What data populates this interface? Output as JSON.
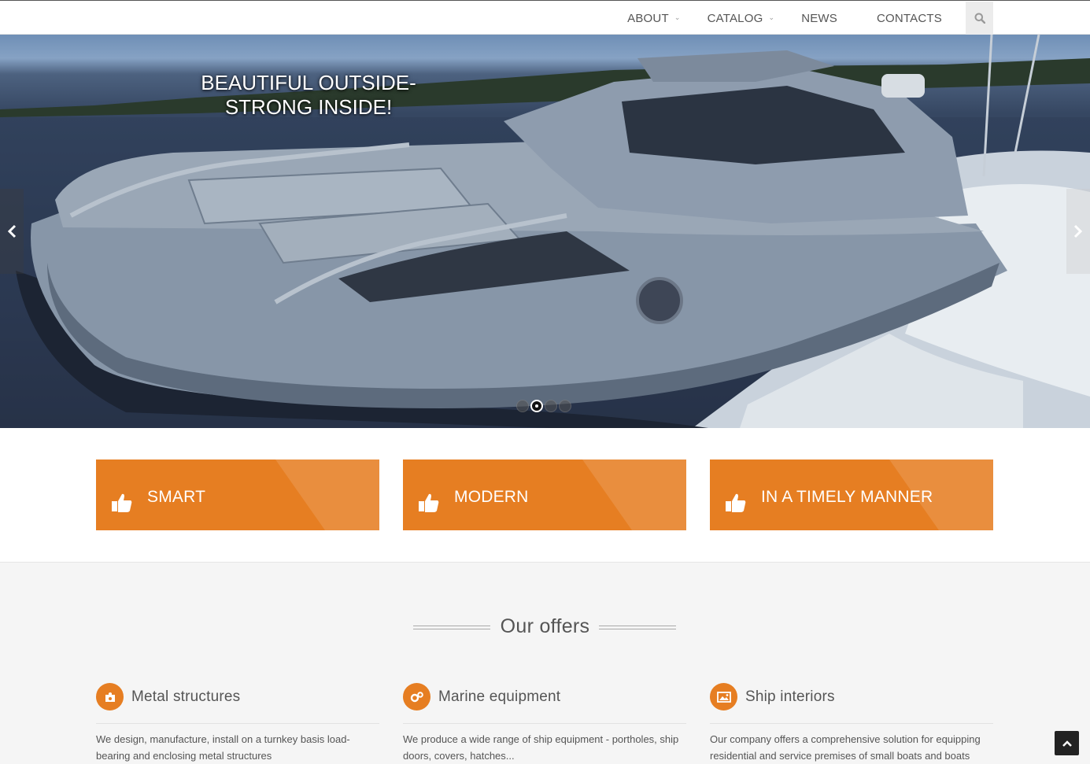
{
  "nav": {
    "items": [
      {
        "label": "ABOUT",
        "dropdown": true
      },
      {
        "label": "CATALOG",
        "dropdown": true
      },
      {
        "label": "NEWS",
        "dropdown": false
      },
      {
        "label": "CONTACTS",
        "dropdown": false
      }
    ],
    "search_icon": "search-icon"
  },
  "hero": {
    "caption_line1": "BEAUTIFUL OUTSIDE-",
    "caption_line2": "STRONG INSIDE!",
    "slide_count": 4,
    "active_slide": 2
  },
  "features": [
    {
      "label": "SMART",
      "icon": "thumbs-up-icon"
    },
    {
      "label": "MODERN",
      "icon": "thumbs-up-icon"
    },
    {
      "label": "IN A TIMELY MANNER",
      "icon": "thumbs-up-icon"
    }
  ],
  "offers": {
    "title": "Our offers",
    "items": [
      {
        "title": "Metal structures",
        "icon": "puzzle-icon",
        "text": "We design, manufacture, install on a turnkey basis load-bearing and enclosing metal structures"
      },
      {
        "title": "Marine equipment",
        "icon": "gears-icon",
        "text": "We produce a wide range of ship equipment - portholes, ship doors, covers, hatches..."
      },
      {
        "title": "Ship interiors",
        "icon": "picture-icon",
        "text": "Our company offers a comprehensive solution for equipping residential and service premises of small boats and boats"
      }
    ]
  },
  "colors": {
    "accent": "#e67e22",
    "accent_dark": "#d9731a"
  }
}
